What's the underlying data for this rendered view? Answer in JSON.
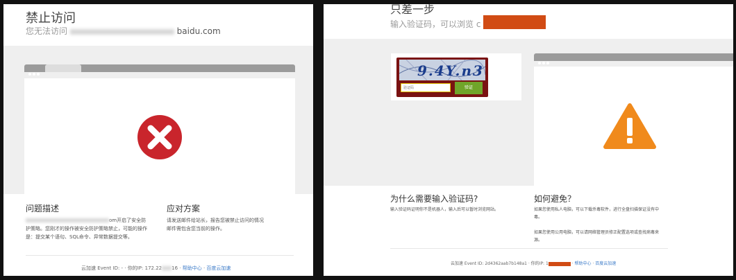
{
  "left": {
    "title": "禁止访问",
    "subtitle_prefix": "您无法访问",
    "subtitle_domain": "baidu.com",
    "section1_title": "问题描述",
    "section1_text_a": "om开启了安全防",
    "section1_text_b": "护策略。您刚才的操作被安全防护策略禁止，可能的操作",
    "section1_text_c": "是：提交某个语句、SQL命令、异常数据提交等。",
    "section2_title": "应对方案",
    "section2_text_a": "请发送邮件给站长，报告您被禁止访问的情况",
    "section2_text_b": "邮件需包含您当前的操作。",
    "footer_prefix": "云加速 Event ID: -  ·  你的IP: 172.22",
    "footer_ip_tail": "16",
    "footer_link1": "帮助中心",
    "footer_sep": " · ",
    "footer_link2": "百度云加速",
    "icon": "error-x-icon",
    "icon_color": "#c9252c"
  },
  "right": {
    "title": "只差一步",
    "subtitle": "输入验证码，可以浏览",
    "subtitle_tail": "c",
    "captcha_text": "9.4Y.n3",
    "captcha_placeholder": "验证码",
    "captcha_button": "验证",
    "section1_title": "为什么需要输入验证码?",
    "section1_text": "输入验证码证明你不是机器人，输入后可以暂时浏览网站。",
    "section2_title": "如何避免？",
    "section2_text_a": "如果您使用私人电脑，可以下载杀毒软件，进行全盘扫描保证没有中",
    "section2_text_b": "毒。",
    "section2_text_c": "如果您使用公用电脑，可以请网络管理员修正配置选项或查找病毒来",
    "section2_text_d": "源。",
    "footer_prefix": "云加速 Event ID: 2d4362aab7b148a1  ·  你的IP: 1",
    "footer_link1": "帮助中心",
    "footer_sep": " · ",
    "footer_link2": "百度云加速",
    "icon": "warning-triangle-icon",
    "icon_color": "#f08a1c",
    "redact_color": "#d14b14"
  }
}
